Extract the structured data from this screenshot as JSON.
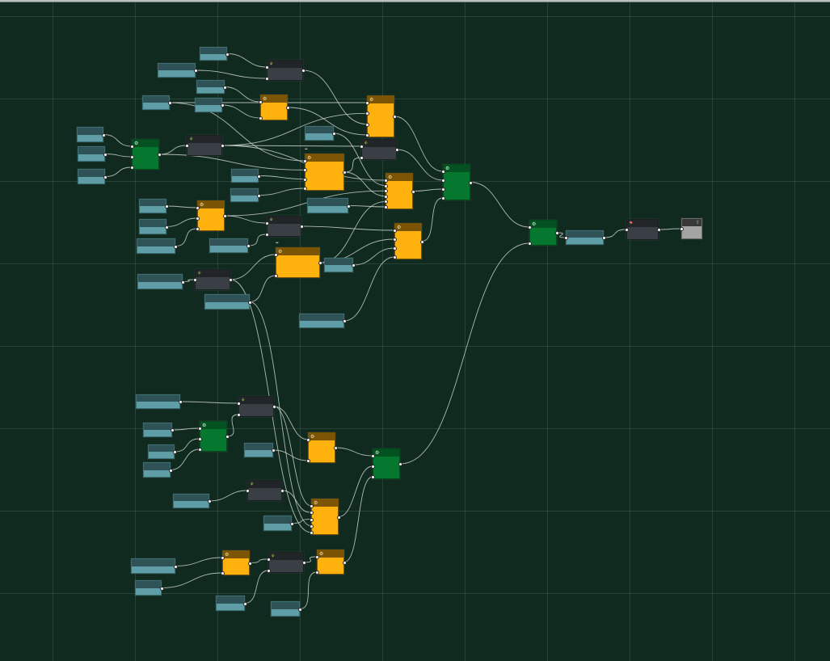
{
  "canvas": {
    "background": "#112a20",
    "grid_color": "#3f5f51"
  },
  "node_types": {
    "input": {
      "body": "#5f9ea6",
      "header": "#2f5256",
      "icon": ""
    },
    "op": {
      "body": "#ffb20d",
      "header": "#7b5503",
      "icon": "gear-icon"
    },
    "cmp": {
      "body": "#3a3f45",
      "header": "#222528",
      "icon": "leaf-icon"
    },
    "grp": {
      "body": "#05772f",
      "header": "#045222",
      "icon": "gear-icon"
    },
    "out": {
      "body": "#a4a4a4",
      "header": "#383838",
      "icon": "export-icon"
    },
    "sink": {
      "body": "#3a3f45",
      "header": "#222528",
      "icon": "flag-icon"
    }
  },
  "nodes": [
    {
      "id": "i1",
      "type": "input"
    },
    {
      "id": "i2",
      "type": "input"
    },
    {
      "id": "i3",
      "type": "input"
    },
    {
      "id": "i4",
      "type": "input"
    },
    {
      "id": "i5",
      "type": "input"
    },
    {
      "id": "i6",
      "type": "input"
    },
    {
      "id": "i7",
      "type": "input"
    },
    {
      "id": "i8",
      "type": "input"
    },
    {
      "id": "i9",
      "type": "input"
    },
    {
      "id": "i10",
      "type": "input"
    },
    {
      "id": "i11",
      "type": "input"
    },
    {
      "id": "i12",
      "type": "input"
    },
    {
      "id": "i13",
      "type": "input"
    },
    {
      "id": "i14",
      "type": "input"
    },
    {
      "id": "i15",
      "type": "input"
    },
    {
      "id": "i16",
      "type": "input"
    },
    {
      "id": "i17",
      "type": "input"
    },
    {
      "id": "i18",
      "type": "input"
    },
    {
      "id": "i19",
      "type": "input"
    },
    {
      "id": "i20",
      "type": "input"
    },
    {
      "id": "i21",
      "type": "input"
    },
    {
      "id": "i22",
      "type": "input"
    },
    {
      "id": "i23",
      "type": "input"
    },
    {
      "id": "i24",
      "type": "input"
    },
    {
      "id": "i25",
      "type": "input"
    },
    {
      "id": "i26",
      "type": "input"
    },
    {
      "id": "i27",
      "type": "input"
    },
    {
      "id": "i28",
      "type": "input"
    },
    {
      "id": "i29",
      "type": "input"
    },
    {
      "id": "i30",
      "type": "input"
    },
    {
      "id": "i31",
      "type": "input"
    },
    {
      "id": "i32",
      "type": "input"
    },
    {
      "id": "i33",
      "type": "input"
    },
    {
      "id": "i34",
      "type": "input"
    },
    {
      "id": "i35",
      "type": "input"
    },
    {
      "id": "c1",
      "type": "cmp"
    },
    {
      "id": "c2",
      "type": "cmp"
    },
    {
      "id": "c3",
      "type": "cmp"
    },
    {
      "id": "c4",
      "type": "cmp"
    },
    {
      "id": "c5",
      "type": "cmp"
    },
    {
      "id": "c6",
      "type": "cmp"
    },
    {
      "id": "c7",
      "type": "cmp"
    },
    {
      "id": "c8",
      "type": "cmp"
    },
    {
      "id": "o1",
      "type": "op"
    },
    {
      "id": "o2",
      "type": "op"
    },
    {
      "id": "o3",
      "type": "op"
    },
    {
      "id": "o4",
      "type": "op"
    },
    {
      "id": "o5",
      "type": "op"
    },
    {
      "id": "o6",
      "type": "op"
    },
    {
      "id": "o7",
      "type": "op"
    },
    {
      "id": "o8",
      "type": "op"
    },
    {
      "id": "o9",
      "type": "op"
    },
    {
      "id": "o10",
      "type": "op"
    },
    {
      "id": "o11",
      "type": "op"
    },
    {
      "id": "g1",
      "type": "grp"
    },
    {
      "id": "g2",
      "type": "grp"
    },
    {
      "id": "g3",
      "type": "grp"
    },
    {
      "id": "g4",
      "type": "grp"
    },
    {
      "id": "g5",
      "type": "grp"
    },
    {
      "id": "s1",
      "type": "sink"
    },
    {
      "id": "out1",
      "type": "out"
    }
  ],
  "edges": [
    [
      "i1",
      "c1"
    ],
    [
      "i2",
      "c1"
    ],
    [
      "i3",
      "o1"
    ],
    [
      "i4",
      "o1"
    ],
    [
      "i5",
      "o2"
    ],
    [
      "i5",
      "o3"
    ],
    [
      "i6",
      "g1"
    ],
    [
      "i7",
      "g1"
    ],
    [
      "i8",
      "g1"
    ],
    [
      "g1",
      "c2"
    ],
    [
      "g1",
      "o3"
    ],
    [
      "c2",
      "o2"
    ],
    [
      "c2",
      "c3"
    ],
    [
      "c1",
      "o2"
    ],
    [
      "o1",
      "o2"
    ],
    [
      "c2",
      "o4"
    ],
    [
      "i9",
      "o3"
    ],
    [
      "i10",
      "o3"
    ],
    [
      "i11",
      "o4"
    ],
    [
      "i12",
      "o5"
    ],
    [
      "i13",
      "o5"
    ],
    [
      "i14",
      "o5"
    ],
    [
      "o5",
      "c4"
    ],
    [
      "o5",
      "o4"
    ],
    [
      "i15",
      "c4"
    ],
    [
      "c4",
      "o6"
    ],
    [
      "o3",
      "o4"
    ],
    [
      "o3",
      "c3"
    ],
    [
      "i16",
      "c5"
    ],
    [
      "c5",
      "o7"
    ],
    [
      "i17",
      "o7"
    ],
    [
      "o7",
      "o6"
    ],
    [
      "o7",
      "o4"
    ],
    [
      "i18",
      "o6"
    ],
    [
      "i19",
      "o6"
    ],
    [
      "i20",
      "o4"
    ],
    [
      "o2",
      "g2"
    ],
    [
      "c3",
      "g2"
    ],
    [
      "o4",
      "g2"
    ],
    [
      "o6",
      "g2"
    ],
    [
      "g2",
      "g3"
    ],
    [
      "g3",
      "i21"
    ],
    [
      "i21",
      "s1"
    ],
    [
      "s1",
      "out1"
    ],
    [
      "i22",
      "c6"
    ],
    [
      "i23",
      "g4"
    ],
    [
      "i24",
      "g4"
    ],
    [
      "i25",
      "g4"
    ],
    [
      "g4",
      "c6"
    ],
    [
      "c6",
      "o8"
    ],
    [
      "c6",
      "o9"
    ],
    [
      "i26",
      "o8"
    ],
    [
      "i27",
      "c7"
    ],
    [
      "c7",
      "o9"
    ],
    [
      "i28",
      "o9"
    ],
    [
      "o8",
      "g5"
    ],
    [
      "o9",
      "g5"
    ],
    [
      "i29",
      "o10"
    ],
    [
      "i30",
      "o10"
    ],
    [
      "o10",
      "c8"
    ],
    [
      "c8",
      "o11"
    ],
    [
      "i31",
      "c8"
    ],
    [
      "i32",
      "o11"
    ],
    [
      "o11",
      "g5"
    ],
    [
      "g5",
      "g3"
    ],
    [
      "i17",
      "o9"
    ],
    [
      "c5",
      "o9"
    ]
  ],
  "badges": [
    {
      "node": "o3",
      "text": "↔"
    },
    {
      "node": "o7",
      "text": "↔"
    }
  ]
}
